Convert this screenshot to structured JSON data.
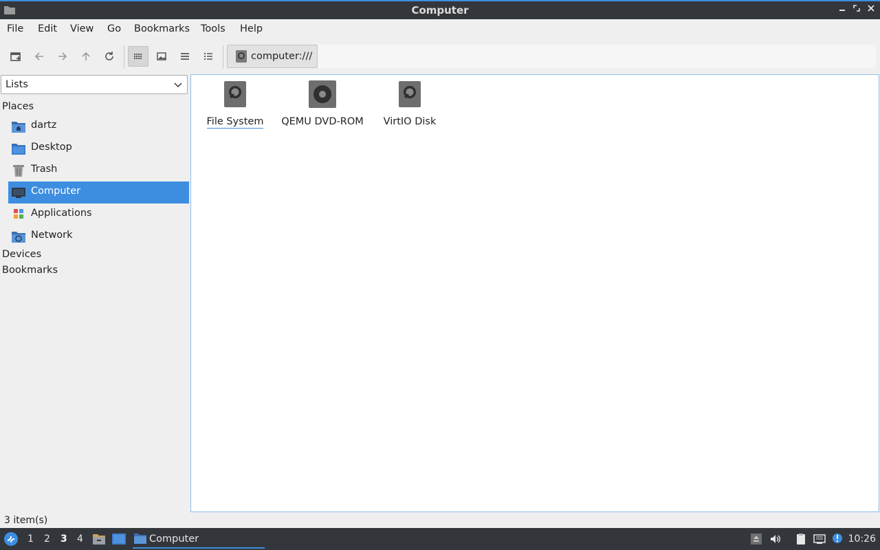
{
  "window": {
    "title": "Computer"
  },
  "menubar": [
    "File",
    "Edit",
    "View",
    "Go",
    "Bookmarks",
    "Tools",
    "Help"
  ],
  "toolbar": {
    "path": "computer:///",
    "buttons": [
      "new-tab-icon",
      "back-arrow-icon",
      "forward-arrow-icon",
      "up-arrow-icon",
      "reload-icon",
      "icon-view-icon",
      "thumbnail-view-icon",
      "compact-view-icon",
      "detailed-list-view-icon"
    ]
  },
  "sidebar": {
    "mode": "Lists",
    "places_heading": "Places",
    "places": [
      {
        "label": "dartz",
        "icon": "home-folder-icon"
      },
      {
        "label": "Desktop",
        "icon": "desktop-icon"
      },
      {
        "label": "Trash",
        "icon": "trash-icon"
      },
      {
        "label": "Computer",
        "icon": "computer-icon",
        "selected": true
      },
      {
        "label": "Applications",
        "icon": "applications-icon"
      },
      {
        "label": "Network",
        "icon": "network-icon"
      }
    ],
    "devices_heading": "Devices",
    "bookmarks_heading": "Bookmarks"
  },
  "main": {
    "items": [
      {
        "label": "File System",
        "icon": "harddisk-icon"
      },
      {
        "label": "QEMU DVD-ROM",
        "icon": "optical-drive-icon"
      },
      {
        "label": "VirtIO Disk",
        "icon": "harddisk-icon"
      }
    ]
  },
  "status": {
    "text": "3 item(s)"
  },
  "taskbar": {
    "workspaces": [
      "1",
      "2",
      "3",
      "4"
    ],
    "current_workspace": "3",
    "task_label": "Computer",
    "clock": "10:26"
  },
  "colors": {
    "accent": "#3d8ee0",
    "titlebar": "#33363b",
    "taskbar": "#33363b"
  }
}
